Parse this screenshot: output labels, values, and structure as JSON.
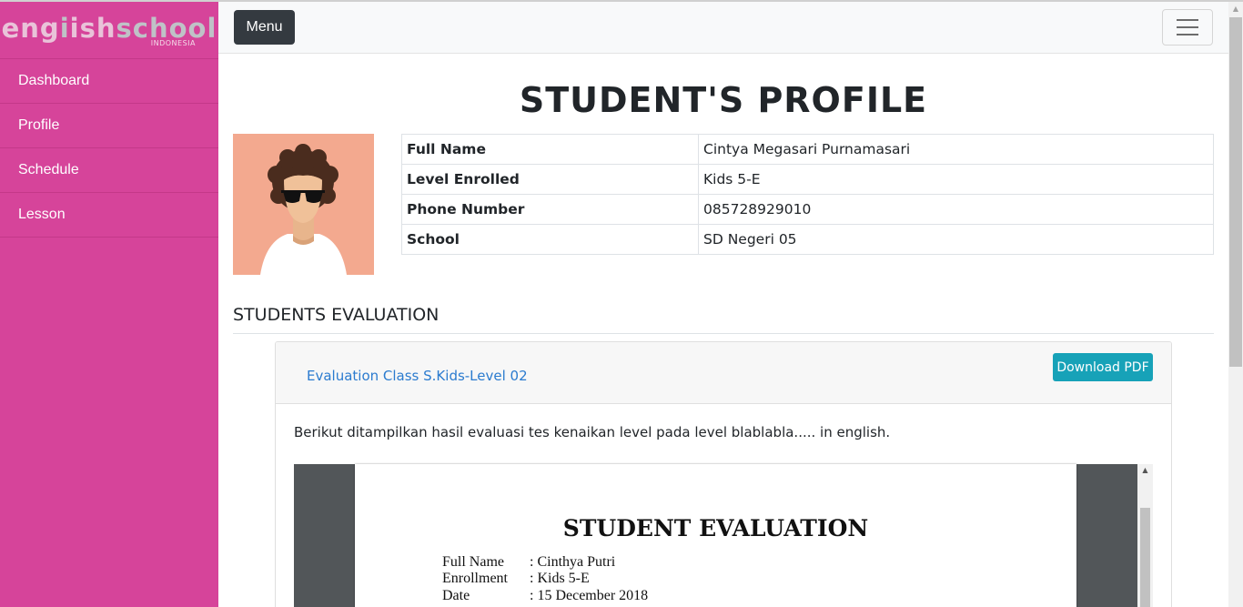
{
  "brand": {
    "logo_part1": "eng",
    "logo_part2": "i",
    "logo_part3": "ish",
    "logo_part4": "school",
    "logo_sub": "INDONESIA"
  },
  "sidebar": {
    "items": [
      {
        "label": "Dashboard"
      },
      {
        "label": "Profile"
      },
      {
        "label": "Schedule"
      },
      {
        "label": "Lesson"
      }
    ]
  },
  "topbar": {
    "menu_label": "Menu",
    "toggle_icon": "hamburger-icon"
  },
  "page": {
    "title": "STUDENT'S PROFILE"
  },
  "profile": {
    "avatar_icon": "user-avatar-icon",
    "rows": [
      {
        "label": "Full Name",
        "value": "Cintya Megasari Purnamasari"
      },
      {
        "label": "Level Enrolled",
        "value": "Kids 5-E"
      },
      {
        "label": "Phone Number",
        "value": "085728929010"
      },
      {
        "label": "School",
        "value": "SD Negeri 05"
      }
    ]
  },
  "evaluation": {
    "section_title": "STUDENTS EVALUATION",
    "card_link": "Evaluation Class S.Kids-Level 02",
    "download_label": "Download PDF",
    "description": "Berikut ditampilkan hasil evaluasi tes kenaikan level pada level blablabla..... in english.",
    "document": {
      "title": "STUDENT EVALUATION",
      "fields": [
        {
          "label": "Full Name",
          "value": ": Cinthya Putri"
        },
        {
          "label": "Enrollment",
          "value": ": Kids 5-E"
        },
        {
          "label": "Date",
          "value": ": 15 December 2018"
        }
      ]
    }
  },
  "colors": {
    "sidebar": "#d6449a",
    "menu_button": "#343a40",
    "download_button": "#17a2b8",
    "link": "#2b7bcf",
    "avatar_bg": "#f3a98f"
  }
}
